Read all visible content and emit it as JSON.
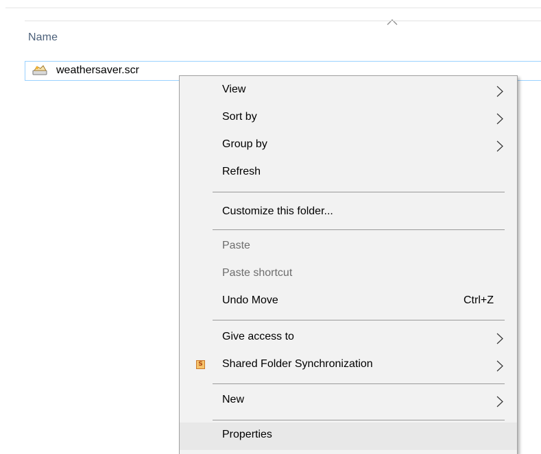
{
  "header": {
    "column_name_label": "Name",
    "sort_icon": "chevron-up-icon"
  },
  "file": {
    "name": "weathersaver.scr",
    "icon": "screensaver-file-icon"
  },
  "context_menu": {
    "items": {
      "view": {
        "label": "View",
        "has_submenu": true,
        "enabled": true
      },
      "sort_by": {
        "label": "Sort by",
        "has_submenu": true,
        "enabled": true
      },
      "group_by": {
        "label": "Group by",
        "has_submenu": true,
        "enabled": true
      },
      "refresh": {
        "label": "Refresh",
        "enabled": true
      },
      "customize": {
        "label": "Customize this folder...",
        "enabled": true
      },
      "paste": {
        "label": "Paste",
        "enabled": false
      },
      "paste_shortcut": {
        "label": "Paste shortcut",
        "enabled": false
      },
      "undo_move": {
        "label": "Undo Move",
        "shortcut": "Ctrl+Z",
        "enabled": true
      },
      "give_access": {
        "label": "Give access to",
        "has_submenu": true,
        "enabled": true
      },
      "shared_sync": {
        "label": "Shared Folder Synchronization",
        "icon_glyph": "S",
        "icon": "sync-app-icon",
        "has_submenu": true,
        "enabled": true
      },
      "new": {
        "label": "New",
        "has_submenu": true,
        "enabled": true
      },
      "properties": {
        "label": "Properties",
        "enabled": true,
        "hovered": true
      }
    }
  },
  "colors": {
    "selection_border": "#99d1ff",
    "menu_background": "#f2f2f2",
    "menu_hover": "#e8e8e8",
    "header_text": "#4c607a",
    "disabled_text": "#6d6d6d"
  }
}
